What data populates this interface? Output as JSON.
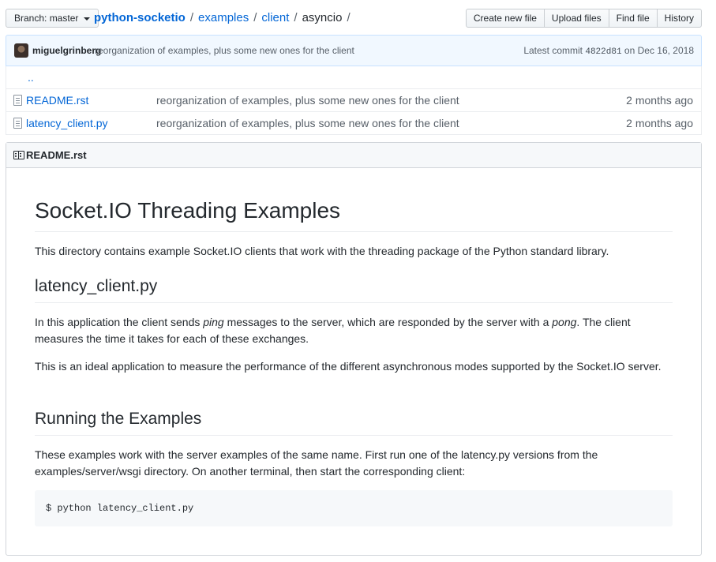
{
  "branch": {
    "label": "Branch: master"
  },
  "breadcrumb": {
    "repo": "python-socketio",
    "parts": [
      "examples",
      "client"
    ],
    "current": "asyncio",
    "separator": "/"
  },
  "actions": {
    "create": "Create new file",
    "upload": "Upload files",
    "find": "Find file",
    "history": "History"
  },
  "commit": {
    "author": "miguelgrinberg",
    "message": "reorganization of examples, plus some new ones for the client",
    "latest_label": "Latest commit",
    "sha": "4822d81",
    "date": "on Dec 16, 2018"
  },
  "files": {
    "updir": "..",
    "rows": [
      {
        "name": "README.rst",
        "message": "reorganization of examples, plus some new ones for the client",
        "age": "2 months ago"
      },
      {
        "name": "latency_client.py",
        "message": "reorganization of examples, plus some new ones for the client",
        "age": "2 months ago"
      }
    ]
  },
  "readme": {
    "filename": "README.rst",
    "h1": "Socket.IO Threading Examples",
    "intro": "This directory contains example Socket.IO clients that work with the threading package of the Python standard library.",
    "h2_latency": "latency_client.py",
    "latency_p1_before": "In this application the client sends ",
    "latency_p1_ping": "ping",
    "latency_p1_middle": " messages to the server, which are responded by the server with a ",
    "latency_p1_pong": "pong",
    "latency_p1_after": ". The client measures the time it takes for each of these exchanges.",
    "latency_p2": "This is an ideal application to measure the performance of the different asynchronous modes supported by the Socket.IO server.",
    "h2_running": "Running the Examples",
    "running_p": "These examples work with the server examples of the same name. First run one of the latency.py versions from the examples/server/wsgi directory. On another terminal, then start the corresponding client:",
    "code": "$ python latency_client.py"
  }
}
